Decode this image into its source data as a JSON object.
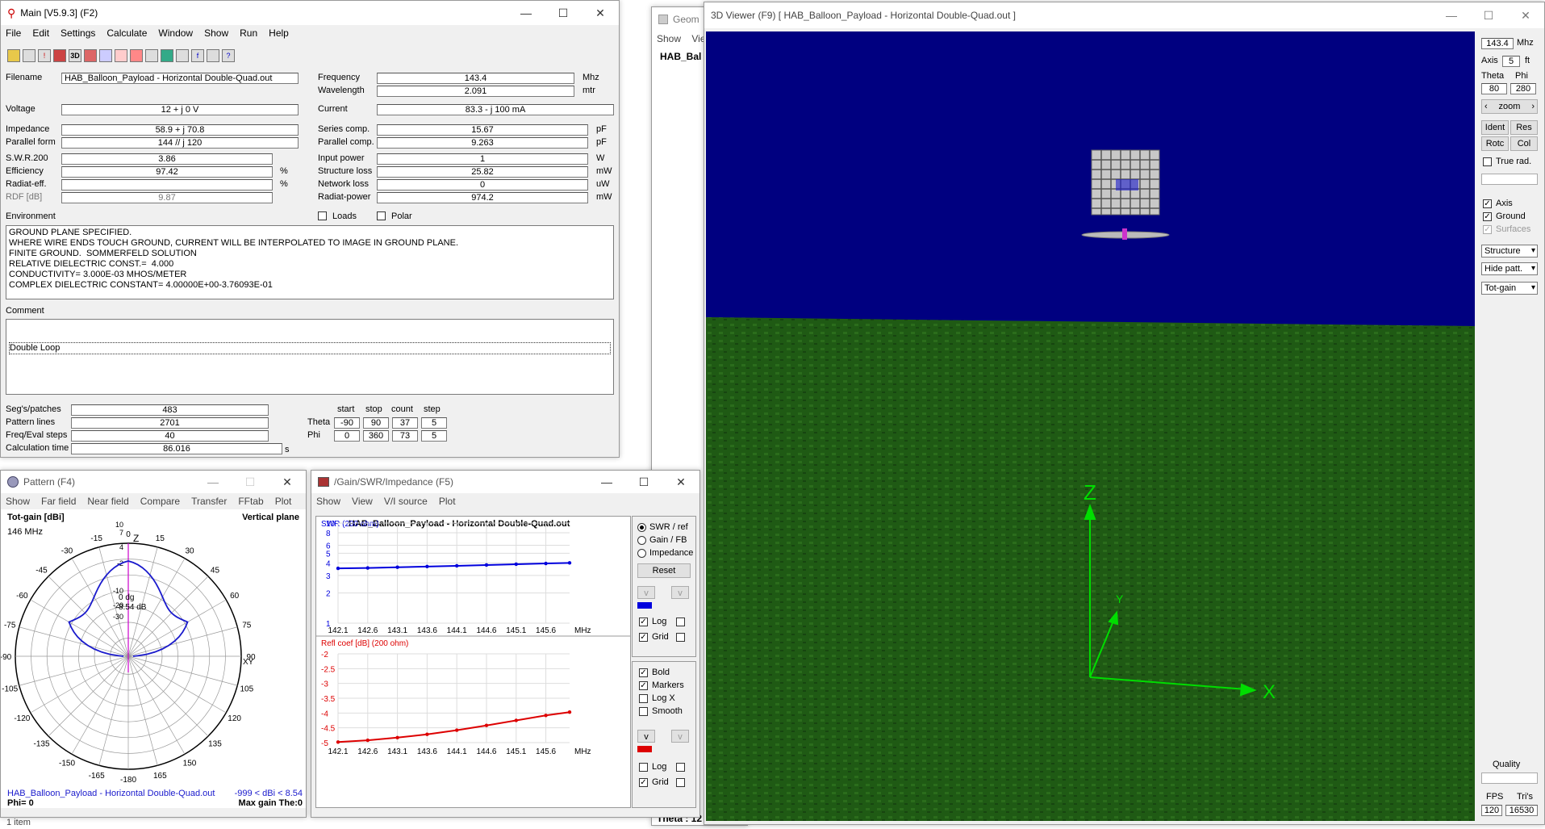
{
  "main": {
    "title": "Main [V5.9.3]   (F2)",
    "menu": [
      "File",
      "Edit",
      "Settings",
      "Calculate",
      "Window",
      "Show",
      "Run",
      "Help"
    ],
    "filename_label": "Filename",
    "filename": "HAB_Balloon_Payload - Horizontal Double-Quad.out",
    "frequency_label": "Frequency",
    "frequency": "143.4",
    "frequency_unit": "Mhz",
    "wavelength_label": "Wavelength",
    "wavelength": "2.091",
    "wavelength_unit": "mtr",
    "voltage_label": "Voltage",
    "voltage": "12 + j 0 V",
    "current_label": "Current",
    "current": "83.3 - j 100 mA",
    "impedance_label": "Impedance",
    "impedance": "58.9 + j 70.8",
    "series_label": "Series comp.",
    "series": "15.67",
    "series_unit": "pF",
    "parallel_form_label": "Parallel form",
    "parallel_form": "144 // j 120",
    "parallel_comp_label": "Parallel comp.",
    "parallel_comp": "9.263",
    "parallel_comp_unit": "pF",
    "swr_label": "S.W.R.200",
    "swr": "3.86",
    "input_power_label": "Input power",
    "input_power": "1",
    "input_power_unit": "W",
    "efficiency_label": "Efficiency",
    "efficiency": "97.42",
    "pct": "%",
    "structure_loss_label": "Structure loss",
    "structure_loss": "25.82",
    "structure_loss_unit": "mW",
    "radiat_eff_label": "Radiat-eff.",
    "network_loss_label": "Network loss",
    "network_loss": "0",
    "network_loss_unit": "uW",
    "rdf_label": "RDF [dB]",
    "rdf": "9.87",
    "radiat_power_label": "Radiat-power",
    "radiat_power": "974.2",
    "radiat_power_unit": "mW",
    "environment_label": "Environment",
    "loads_label": "Loads",
    "polar_label": "Polar",
    "environment_lines": [
      "GROUND PLANE SPECIFIED.",
      "WHERE WIRE ENDS TOUCH GROUND, CURRENT WILL BE INTERPOLATED TO IMAGE IN GROUND PLANE.",
      "FINITE GROUND.  SOMMERFELD SOLUTION",
      "RELATIVE DIELECTRIC CONST.=  4.000",
      "CONDUCTIVITY= 3.000E-03 MHOS/METER",
      "COMPLEX DIELECTRIC CONSTANT= 4.00000E+00-3.76093E-01"
    ],
    "comment_label": "Comment",
    "comment": "Double Loop",
    "segs_label": "Seg's/patches",
    "segs": "483",
    "pattern_lines_label": "Pattern lines",
    "pattern_lines": "2701",
    "freq_steps_label": "Freq/Eval steps",
    "freq_steps": "40",
    "calc_time_label": "Calculation time",
    "calc_time": "86.016",
    "calc_time_unit": "s",
    "grid_headers": [
      "start",
      "stop",
      "count",
      "step"
    ],
    "theta_label": "Theta",
    "theta": [
      "-90",
      "90",
      "37",
      "5"
    ],
    "phi_label": "Phi",
    "phi": [
      "0",
      "360",
      "73",
      "5"
    ]
  },
  "geometry": {
    "title": "Geom",
    "menu_show": "Show",
    "menu_view": "Vie",
    "name": "HAB_Bal",
    "footer": "Theta : 12"
  },
  "pattern": {
    "title": "Pattern    (F4)",
    "menu": [
      "Show",
      "Far field",
      "Near field",
      "Compare",
      "Transfer",
      "FFtab",
      "Plot"
    ],
    "gain_label": "Tot-gain [dBi]",
    "plane": "Vertical plane",
    "freq": "146 MHz",
    "angle_labels": [
      "0",
      "15",
      "30",
      "45",
      "60",
      "75",
      "90",
      "105",
      "120",
      "135",
      "150",
      "165",
      "-180",
      "-165",
      "-150",
      "-135",
      "-120",
      "-105",
      "-90",
      "-75",
      "-60",
      "-45",
      "-30",
      "-15"
    ],
    "ring_labels": [
      "10",
      "7",
      "4",
      "-2",
      "-10",
      "-20",
      "-30"
    ],
    "z_label": "Z",
    "xy_label": "XY",
    "center_dg": "0 dg",
    "center_db": "8.54 dB",
    "file": "HAB_Balloon_Payload - Horizontal Double-Quad.out",
    "range": "-999 < dBi < 8.54",
    "phi": "Phi= 0",
    "max_gain": "Max gain The:0",
    "pattern_color": "#1a1acc"
  },
  "status_bar": "1 item",
  "swr": {
    "title": "/Gain/SWR/Impedance (F5)",
    "menu": [
      "Show",
      "View",
      "V/I source",
      "Plot"
    ],
    "chart_title": "HAB_Balloon_Payload - Horizontal Double-Quad.out",
    "swr_label": "SWR (200 ohm)",
    "refl_label": "Refl coef [dB] (200 ohm)",
    "x_ticks": [
      "142.1",
      "142.6",
      "143.1",
      "143.6",
      "144.1",
      "144.6",
      "145.1",
      "145.6"
    ],
    "x_unit": "MHz",
    "swr_ticks": [
      "10",
      "8",
      "6",
      "5",
      "4",
      "3",
      "2",
      "1"
    ],
    "refl_ticks": [
      "-2",
      "-2.5",
      "-3",
      "-3.5",
      "-4",
      "-4.5",
      "-5"
    ],
    "radios": [
      "SWR / ref",
      "Gain / FB",
      "Impedance"
    ],
    "reset": "Reset",
    "log": "Log",
    "grid": "Grid",
    "bold": "Bold",
    "markers": "Markers",
    "logx": "Log X",
    "smooth": "Smooth",
    "v_btn": "v",
    "swr_color": "#0000dd",
    "refl_color": "#dd0000"
  },
  "chart_data": [
    {
      "type": "line",
      "title": "HAB_Balloon_Payload - Horizontal Double-Quad.out",
      "ylabel": "SWR (200 ohm)",
      "xlabel": "MHz",
      "x": [
        142.1,
        142.6,
        143.1,
        143.6,
        144.1,
        144.6,
        145.1,
        145.6,
        146.0
      ],
      "series": [
        {
          "name": "SWR (200 ohm)",
          "values": [
            3.53,
            3.56,
            3.62,
            3.68,
            3.74,
            3.81,
            3.88,
            3.95,
            4.0
          ]
        }
      ],
      "yscale": "log",
      "ylim": [
        1,
        10
      ],
      "grid": true
    },
    {
      "type": "line",
      "ylabel": "Refl coef [dB] (200 ohm)",
      "xlabel": "MHz",
      "x": [
        142.1,
        142.6,
        143.1,
        143.6,
        144.1,
        144.6,
        145.1,
        145.6,
        146.0
      ],
      "series": [
        {
          "name": "Refl coef [dB] (200 ohm)",
          "values": [
            -4.98,
            -4.92,
            -4.83,
            -4.72,
            -4.58,
            -4.42,
            -4.25,
            -4.08,
            -3.97
          ]
        }
      ],
      "ylim": [
        -5,
        -2
      ],
      "grid": true
    }
  ],
  "viewer": {
    "title": "3D Viewer (F9)    [  HAB_Balloon_Payload - Horizontal Double-Quad.out ]",
    "freq": "143.4",
    "freq_unit": "Mhz",
    "axis_label": "Axis",
    "axis": "5",
    "axis_unit": "ft",
    "theta_label": "Theta",
    "phi_label": "Phi",
    "theta": "80",
    "phi": "280",
    "zoom": "zoom",
    "ident": "Ident",
    "res": "Res",
    "rotc": "Rotc",
    "col": "Col",
    "true_rad": "True rad.",
    "axis_chk": "Axis",
    "ground_chk": "Ground",
    "surfaces_chk": "Surfaces",
    "structure": "Structure",
    "hide_patt": "Hide patt.",
    "tot_gain": "Tot-gain",
    "quality": "Quality",
    "fps_label": "FPS",
    "tris_label": "Tri's",
    "fps": "120",
    "tris": "16530",
    "axis_x": "X",
    "axis_y": "Y",
    "axis_z": "Z",
    "sky_color": "#000080",
    "ground_color": "#1f5a14"
  }
}
